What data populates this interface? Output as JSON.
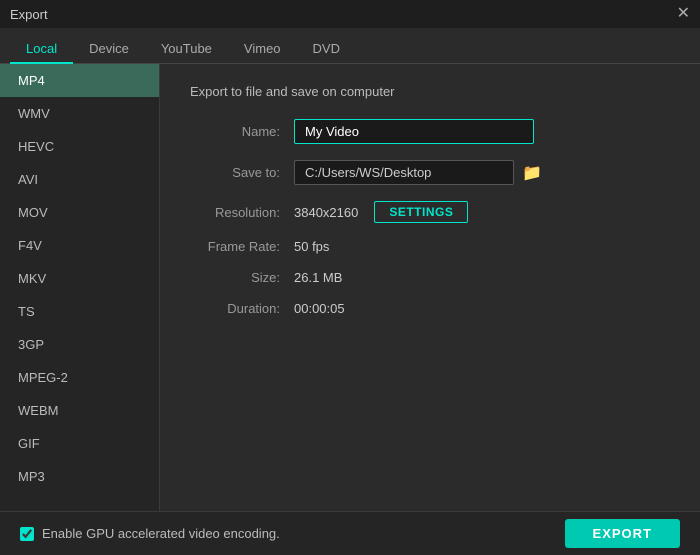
{
  "titleBar": {
    "title": "Export",
    "closeLabel": "✕"
  },
  "tabs": [
    {
      "id": "local",
      "label": "Local",
      "active": true
    },
    {
      "id": "device",
      "label": "Device",
      "active": false
    },
    {
      "id": "youtube",
      "label": "YouTube",
      "active": false
    },
    {
      "id": "vimeo",
      "label": "Vimeo",
      "active": false
    },
    {
      "id": "dvd",
      "label": "DVD",
      "active": false
    }
  ],
  "sidebar": {
    "items": [
      {
        "id": "mp4",
        "label": "MP4",
        "active": true
      },
      {
        "id": "wmv",
        "label": "WMV",
        "active": false
      },
      {
        "id": "hevc",
        "label": "HEVC",
        "active": false
      },
      {
        "id": "avi",
        "label": "AVI",
        "active": false
      },
      {
        "id": "mov",
        "label": "MOV",
        "active": false
      },
      {
        "id": "f4v",
        "label": "F4V",
        "active": false
      },
      {
        "id": "mkv",
        "label": "MKV",
        "active": false
      },
      {
        "id": "ts",
        "label": "TS",
        "active": false
      },
      {
        "id": "3gp",
        "label": "3GP",
        "active": false
      },
      {
        "id": "mpeg2",
        "label": "MPEG-2",
        "active": false
      },
      {
        "id": "webm",
        "label": "WEBM",
        "active": false
      },
      {
        "id": "gif",
        "label": "GIF",
        "active": false
      },
      {
        "id": "mp3",
        "label": "MP3",
        "active": false
      }
    ]
  },
  "content": {
    "sectionTitle": "Export to file and save on computer",
    "fields": {
      "nameLabel": "Name:",
      "nameValue": "My Video",
      "saveToLabel": "Save to:",
      "saveToValue": "C:/Users/WS/Desktop",
      "resolutionLabel": "Resolution:",
      "resolutionValue": "3840x2160",
      "settingsLabel": "SETTINGS",
      "frameRateLabel": "Frame Rate:",
      "frameRateValue": "50 fps",
      "sizeLabel": "Size:",
      "sizeValue": "26.1 MB",
      "durationLabel": "Duration:",
      "durationValue": "00:00:05"
    }
  },
  "footer": {
    "checkboxLabel": "Enable GPU accelerated video encoding.",
    "exportLabel": "EXPORT"
  },
  "icons": {
    "folder": "🗁",
    "close": "✕"
  }
}
